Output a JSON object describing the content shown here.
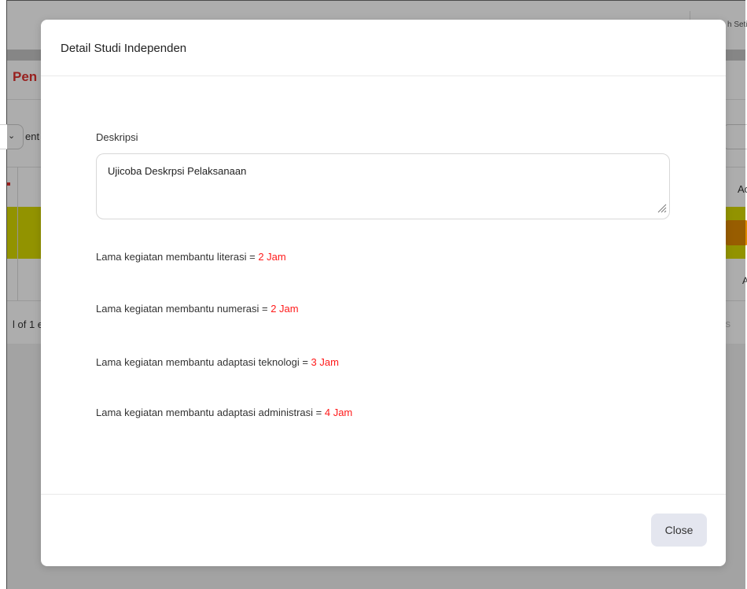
{
  "background": {
    "user_label": "h Seti",
    "card_title": "Pen",
    "entries_text": "ent",
    "table_header_action": "Ac",
    "row_action_text": "A",
    "info_text": "l of 1 e",
    "prev_text": "ous"
  },
  "modal": {
    "title": "Detail Studi Independen",
    "description_label": "Deskripsi",
    "description_value": "Ujicoba Deskrpsi Pelaksanaan",
    "stats": [
      {
        "label": "Lama kegiatan membantu literasi = ",
        "value": "2 Jam"
      },
      {
        "label": "Lama kegiatan membantu numerasi = ",
        "value": "2 Jam"
      },
      {
        "label": "Lama kegiatan membantu adaptasi teknologi = ",
        "value": "3 Jam"
      },
      {
        "label": "Lama kegiatan membantu adaptasi administrasi = ",
        "value": "4 Jam"
      }
    ],
    "close_label": "Close"
  },
  "colors": {
    "value_red": "#ff1a1a",
    "title_red": "#e0312f",
    "row_yellow": "#d7d900",
    "button_bg": "#e4e6ef"
  }
}
